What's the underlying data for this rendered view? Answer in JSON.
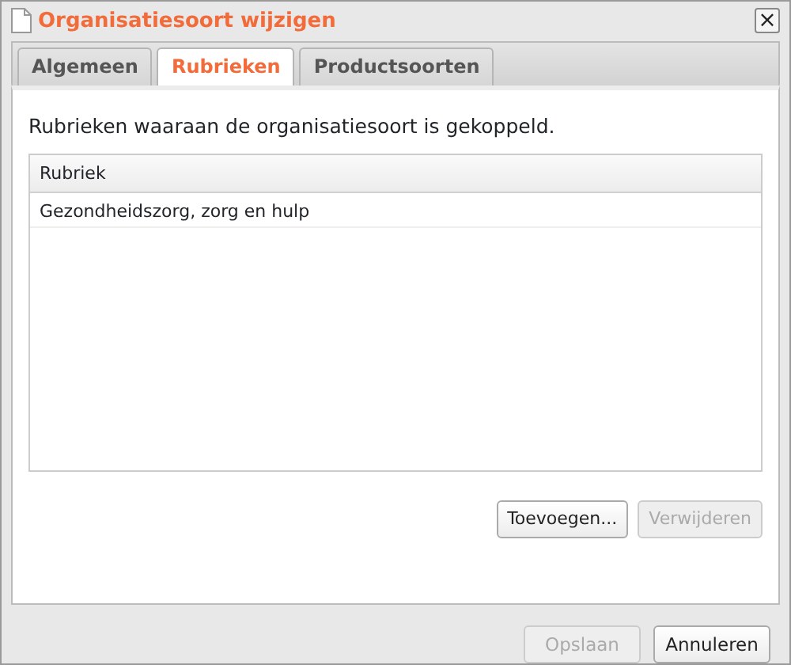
{
  "window": {
    "title": "Organisatiesoort wijzigen",
    "close": "×"
  },
  "tabs": [
    {
      "label": "Algemeen",
      "selected": false
    },
    {
      "label": "Rubrieken",
      "selected": true
    },
    {
      "label": "Productsoorten",
      "selected": false
    }
  ],
  "description": "Rubrieken waaraan de organisatiesoort is gekoppeld.",
  "table": {
    "columns": [
      "Rubriek"
    ],
    "rows": [
      [
        "Gezondheidszorg, zorg en hulp"
      ]
    ]
  },
  "panel_buttons": [
    {
      "label": "Toevoegen...",
      "disabled": false
    },
    {
      "label": "Verwijderen",
      "disabled": true
    }
  ],
  "footer_buttons": [
    {
      "label": "Opslaan",
      "disabled": true
    },
    {
      "label": "Annuleren",
      "disabled": false
    }
  ]
}
